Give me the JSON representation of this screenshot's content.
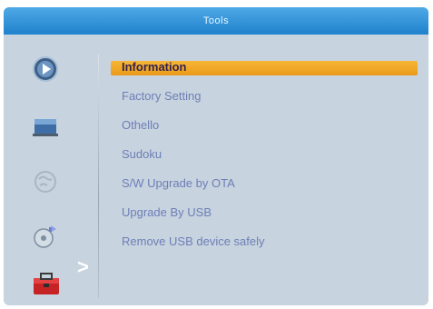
{
  "window": {
    "title": "Tools"
  },
  "menu": {
    "items": [
      {
        "label": "Information",
        "selected": true
      },
      {
        "label": "Factory Setting",
        "selected": false
      },
      {
        "label": "Othello",
        "selected": false
      },
      {
        "label": "Sudoku",
        "selected": false
      },
      {
        "label": "S/W Upgrade by OTA",
        "selected": false
      },
      {
        "label": "Upgrade By USB",
        "selected": false
      },
      {
        "label": "Remove USB device safely",
        "selected": false
      }
    ]
  },
  "sidebar": {
    "icons": [
      {
        "name": "media-player-icon"
      },
      {
        "name": "tv-picture-icon"
      },
      {
        "name": "globe-network-icon"
      },
      {
        "name": "disc-settings-icon"
      },
      {
        "name": "toolbox-icon",
        "active": true
      }
    ],
    "active_arrow": ">"
  },
  "colors": {
    "title_bar": "#2a8fd6",
    "background": "#c7d3df",
    "highlight": "#f2a52a",
    "text": "#6e7fb6",
    "selected_text": "#33224e"
  }
}
